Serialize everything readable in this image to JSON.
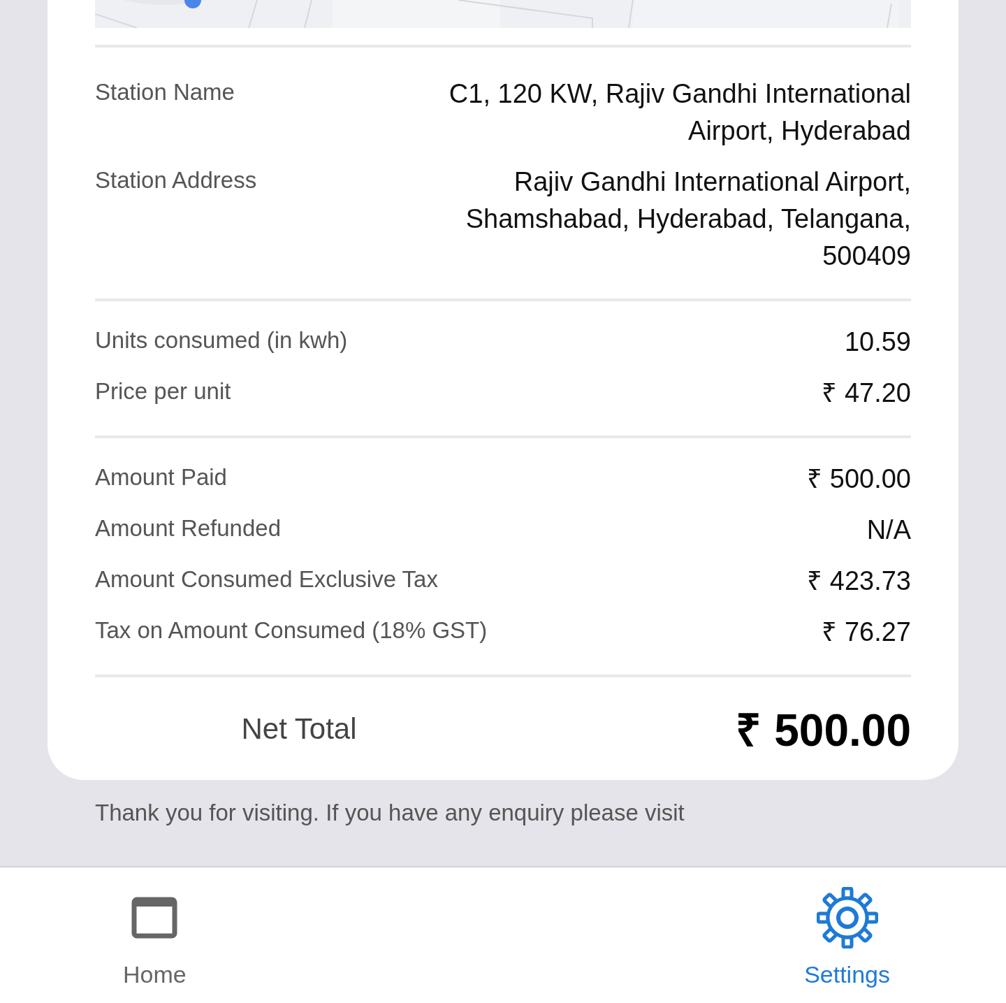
{
  "sections": [
    {
      "rows": [
        {
          "label": "Station Name",
          "value": "C1, 120 KW, Rajiv Gandhi International Airport, Hyderabad"
        },
        {
          "label": "Station Address",
          "value": "Rajiv Gandhi International Airport, Shamshabad, Hyderabad, Telangana, 500409"
        }
      ]
    },
    {
      "rows": [
        {
          "label": "Units consumed (in kwh)",
          "value": "10.59"
        },
        {
          "label": "Price per unit",
          "value": "₹ 47.20"
        }
      ]
    },
    {
      "rows": [
        {
          "label": "Amount Paid",
          "value": "₹ 500.00"
        },
        {
          "label": "Amount Refunded",
          "value": "N/A"
        },
        {
          "label": "Amount Consumed Exclusive Tax",
          "value": "₹ 423.73"
        },
        {
          "label": "Tax on Amount Consumed (18% GST)",
          "value": "₹ 76.27"
        }
      ]
    }
  ],
  "net_total": {
    "label": "Net Total",
    "value": "₹ 500.00"
  },
  "footer_note": "Thank you for visiting. If you have any enquiry please visit",
  "bottom_nav": [
    {
      "label": "Home",
      "selected": false
    },
    {
      "label": "Settings",
      "selected": true
    }
  ]
}
